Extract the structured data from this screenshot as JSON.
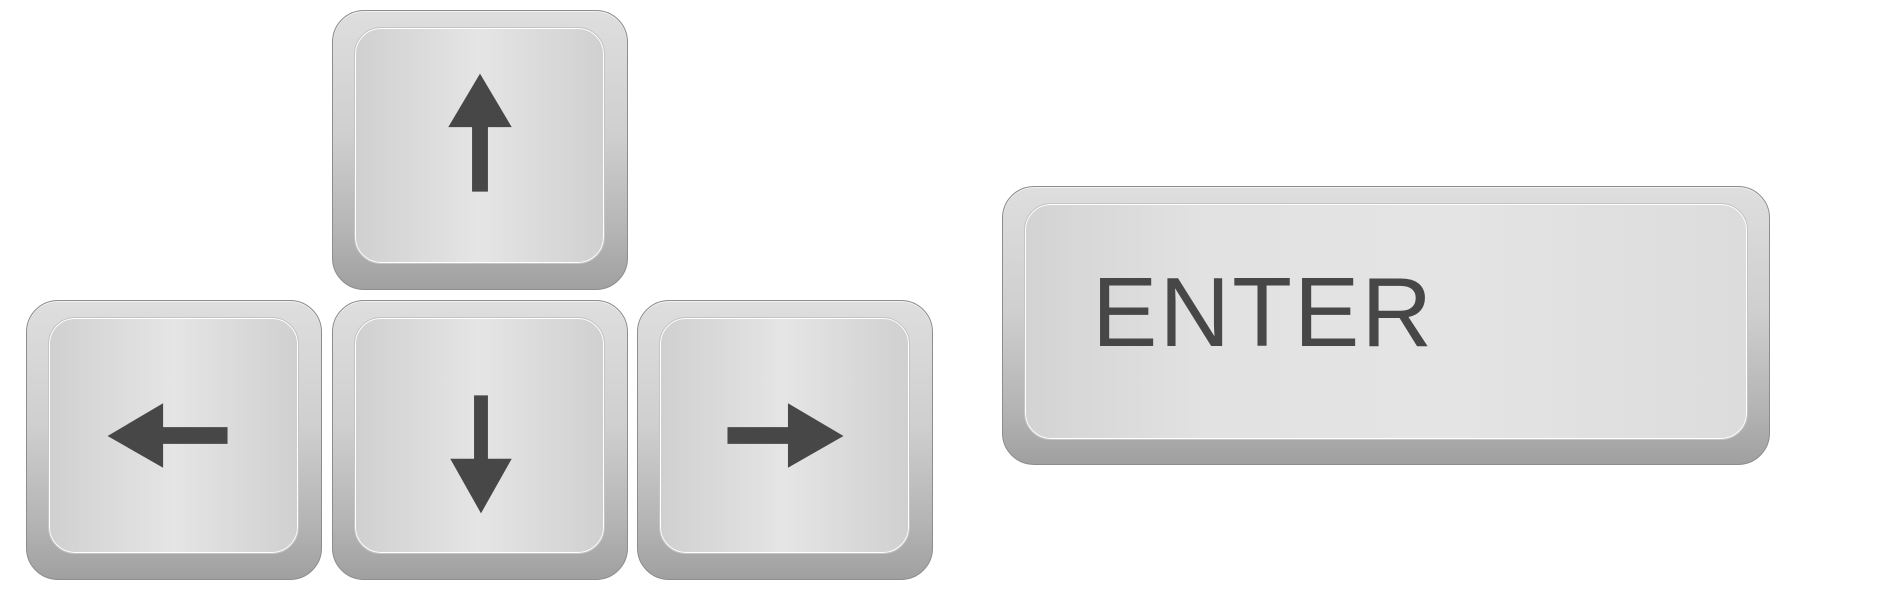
{
  "keys": [
    {
      "id": "up",
      "icon": "arrow-up-icon"
    },
    {
      "id": "left",
      "icon": "arrow-left-icon"
    },
    {
      "id": "down",
      "icon": "arrow-down-icon"
    },
    {
      "id": "right",
      "icon": "arrow-right-icon"
    },
    {
      "id": "enter",
      "label": "ENTER"
    }
  ],
  "colors": {
    "glyph": "#474747",
    "key_face": "#e0e0e0",
    "key_edge": "#a0a0a0"
  }
}
